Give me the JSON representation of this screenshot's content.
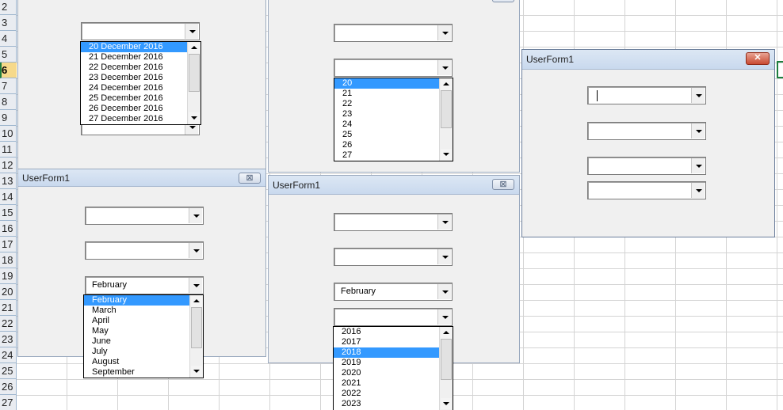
{
  "sheet": {
    "row_numbers": [
      "2",
      "3",
      "4",
      "5",
      "6",
      "7",
      "8",
      "9",
      "10",
      "11",
      "12",
      "13",
      "14",
      "15",
      "16",
      "17",
      "18",
      "19",
      "20",
      "21",
      "22",
      "23",
      "24",
      "25",
      "26",
      "27"
    ],
    "selected_row": "6"
  },
  "forms": {
    "top_left": {
      "date_combo_value": "",
      "date_list": [
        "20 December 2016",
        "21 December 2016",
        "22 December 2016",
        "23 December 2016",
        "24 December 2016",
        "25 December 2016",
        "26 December 2016",
        "27 December 2016"
      ]
    },
    "top_middle": {
      "day_list": [
        "20",
        "21",
        "22",
        "23",
        "24",
        "25",
        "26",
        "27"
      ]
    },
    "right": {
      "title": "UserForm1",
      "close_glyph": "✕"
    },
    "bottom_left": {
      "title": "UserForm1",
      "close_glyph": "⊠",
      "month_value": "February",
      "month_list": [
        "February",
        "March",
        "April",
        "May",
        "June",
        "July",
        "August",
        "September"
      ]
    },
    "bottom_middle": {
      "title": "UserForm1",
      "close_glyph": "⊠",
      "month_value": "February",
      "year_list": [
        "2016",
        "2017",
        "2018",
        "2019",
        "2020",
        "2021",
        "2022",
        "2023"
      ]
    }
  }
}
